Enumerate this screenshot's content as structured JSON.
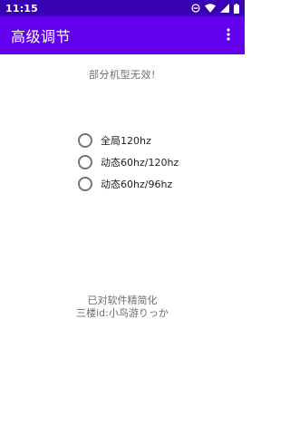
{
  "status_bar": {
    "time": "11:15",
    "icons": [
      "do-not-disturb-icon",
      "wifi-icon",
      "cellular-signal-icon",
      "battery-icon"
    ]
  },
  "app_bar": {
    "title": "高级调节",
    "overflow_icon": "more-vert-icon"
  },
  "notice": "部分机型无效!",
  "refresh_options": [
    {
      "label": "全局120hz",
      "selected": false
    },
    {
      "label": "动态60hz/120hz",
      "selected": false
    },
    {
      "label": "动态60hz/96hz",
      "selected": false
    }
  ],
  "footer": {
    "line1": "已对软件精简化",
    "line2": "三楼id:小鸟游りっか"
  },
  "colors": {
    "status_bar": "#3700b3",
    "app_bar": "#6200ee",
    "background": "#ffffff",
    "secondary_text": "#6d6d6d",
    "radio_outline": "#757575"
  }
}
